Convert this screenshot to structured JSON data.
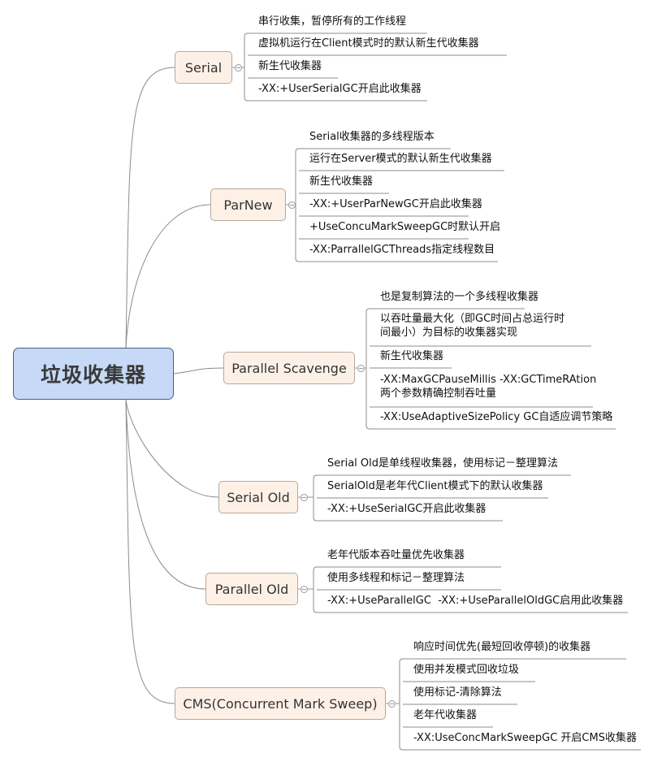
{
  "root": {
    "label": "垃圾收集器"
  },
  "branches": [
    {
      "id": "serial",
      "label": "Serial",
      "leaves": [
        "串行收集，暂停所有的工作线程",
        "虚拟机运行在Client模式时的默认新生代收集器",
        "新生代收集器",
        "-XX:+UserSerialGC开启此收集器"
      ]
    },
    {
      "id": "parnew",
      "label": "ParNew",
      "leaves": [
        "Serial收集器的多线程版本",
        "运行在Server模式的默认新生代收集器",
        "新生代收集器",
        "-XX:+UserParNewGC开启此收集器",
        "+UseConcuMarkSweepGC时默认开启",
        "-XX:ParrallelGCThreads指定线程数目"
      ]
    },
    {
      "id": "parallel-scavenge",
      "label": "Parallel Scavenge",
      "leaves": [
        "也是复制算法的一个多线程收集器",
        "以吞吐量最大化（即GC时间占总运行时\n间最小）为目标的收集器实现",
        "新生代收集器",
        "-XX:MaxGCPauseMillis -XX:GCTimeRAtion\n两个参数精确控制吞吐量",
        "-XX:UseAdaptiveSizePolicy GC自适应调节策略"
      ]
    },
    {
      "id": "serial-old",
      "label": "Serial Old",
      "leaves": [
        "Serial Old是单线程收集器，使用标记－整理算法",
        "SerialOld是老年代Client模式下的默认收集器",
        "-XX:+UseSerialGC开启此收集器"
      ]
    },
    {
      "id": "parallel-old",
      "label": "Parallel Old",
      "leaves": [
        "老年代版本吞吐量优先收集器",
        "使用多线程和标记－整理算法",
        "-XX:+UseParallelGC  -XX:+UseParallelOldGC启用此收集器"
      ]
    },
    {
      "id": "cms",
      "label": "CMS(Concurrent Mark Sweep)",
      "leaves": [
        "响应时间优先(最短回收停顿)的收集器",
        "使用并发模式回收垃圾",
        "使用标记-清除算法",
        "老年代收集器",
        "-XX:UseConcMarkSweepGC 开启CMS收集器"
      ]
    }
  ]
}
